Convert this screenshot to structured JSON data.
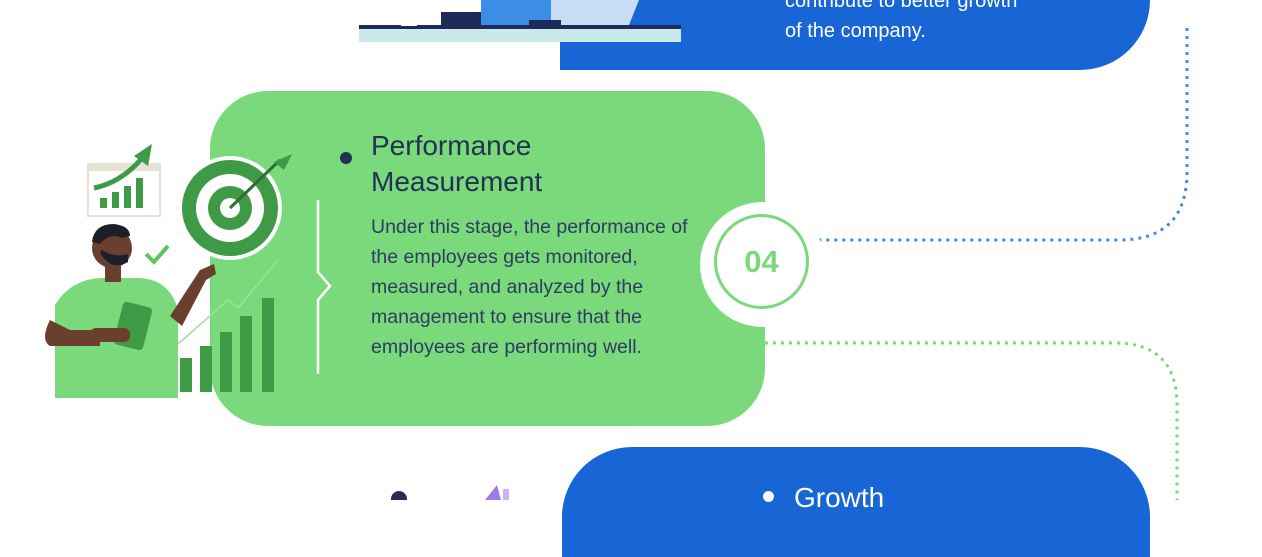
{
  "colors": {
    "blue": "#1865d6",
    "green": "#7ad97a",
    "dark_green": "#3f9a45",
    "navy": "#233154",
    "dot_blue": "#3b8de6",
    "dot_green": "#7ad97a"
  },
  "top_card": {
    "text_partial": "contribute to better growth",
    "text_line": "of the company."
  },
  "stage": {
    "title": "Performance Measurement",
    "body": "Under this stage, the performance of the employees gets monitored, measured, and analyzed by the management to ensure that the employees are performing well.",
    "number": "04"
  },
  "bottom_card": {
    "title": "Growth"
  },
  "illustration": {
    "icons": [
      "bar-chart-icon",
      "target-icon",
      "checkmark-icon",
      "growth-bars-icon"
    ]
  }
}
